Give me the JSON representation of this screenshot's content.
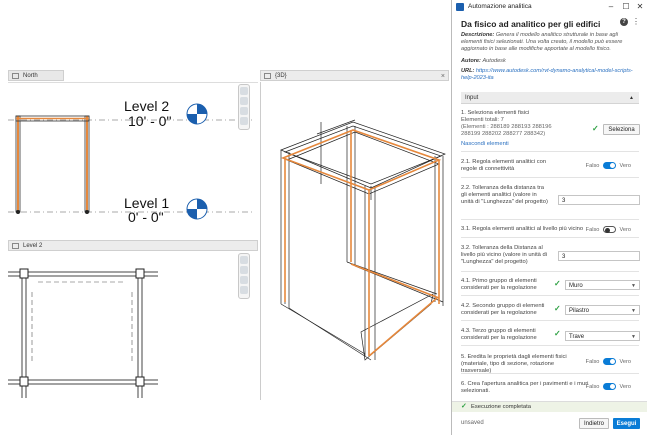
{
  "views": {
    "elevation_tab": "North",
    "plan_tab": "Level 2",
    "view3d_tab": "{3D}",
    "level2": {
      "name": "Level 2",
      "elevation": "10' - 0\""
    },
    "level1": {
      "name": "Level 1",
      "elevation": "0' - 0\""
    }
  },
  "panel": {
    "window_title": "Automazione analitica",
    "title": "Da fisico ad analitico per gli edifici",
    "description_label": "Descrizione:",
    "description": "Genera il modello analitico strutturale in base agli elementi fisici selezionati. Una volta creato, il modello può essere aggiornato in base alle modifiche apportate al modello fisico.",
    "author_label": "Autore:",
    "author": "Autodesk",
    "url_label": "URL:",
    "url": "https://www.autodesk.com/rvt-dynamo-analytical-model-scripts-help-2023-ita",
    "input_section": "Input",
    "step1": {
      "label": "1. Seleziona elementi fisici",
      "total": "Elementi totali: 7",
      "ids": "(Elementi : 288189 288193 288196 288199 288202 288277 288342)",
      "button": "Seleziona",
      "hide_link": "Nascondi elementi"
    },
    "step2_1": {
      "label": "2.1. Regola elementi analitici con regole di connettività",
      "false": "Falso",
      "true": "Vero"
    },
    "step2_2": {
      "label": "2.2. Tolleranza della distanza tra gli elementi analitici (valore in unità di \"Lunghezza\" del progetto)",
      "value": "3"
    },
    "step3_1": {
      "label": "3.1. Regola elementi analitici al livello più vicino",
      "false": "Falso",
      "true": "Vero"
    },
    "step3_2": {
      "label": "3.2. Tolleranza della Distanza al livello più vicino (valore in unità di \"Lunghezza\" del progetto)",
      "value": "3"
    },
    "step4_1": {
      "label": "4.1. Primo gruppo di elementi considerati per la regolazione",
      "value": "Muro"
    },
    "step4_2": {
      "label": "4.2. Secondo gruppo di elementi considerati per la regolazione",
      "value": "Pilastro"
    },
    "step4_3": {
      "label": "4.3. Terzo gruppo di elementi considerati per la regolazione",
      "value": "Trave"
    },
    "step5": {
      "label": "5. Eredita le proprietà dagli elementi fisici (materiale, tipo di sezione, rotazione trasversale)",
      "false": "Falso",
      "true": "Vero"
    },
    "step6": {
      "label": "6. Crea l'apertura analitica per i pavimenti e i muri selezionati.",
      "false": "Falso",
      "true": "Vero"
    },
    "status": "Esecuzione completata",
    "footer_state": "unsaved",
    "back_button": "Indietro",
    "run_button": "Esegui",
    "accent": "#0a7cd6"
  }
}
